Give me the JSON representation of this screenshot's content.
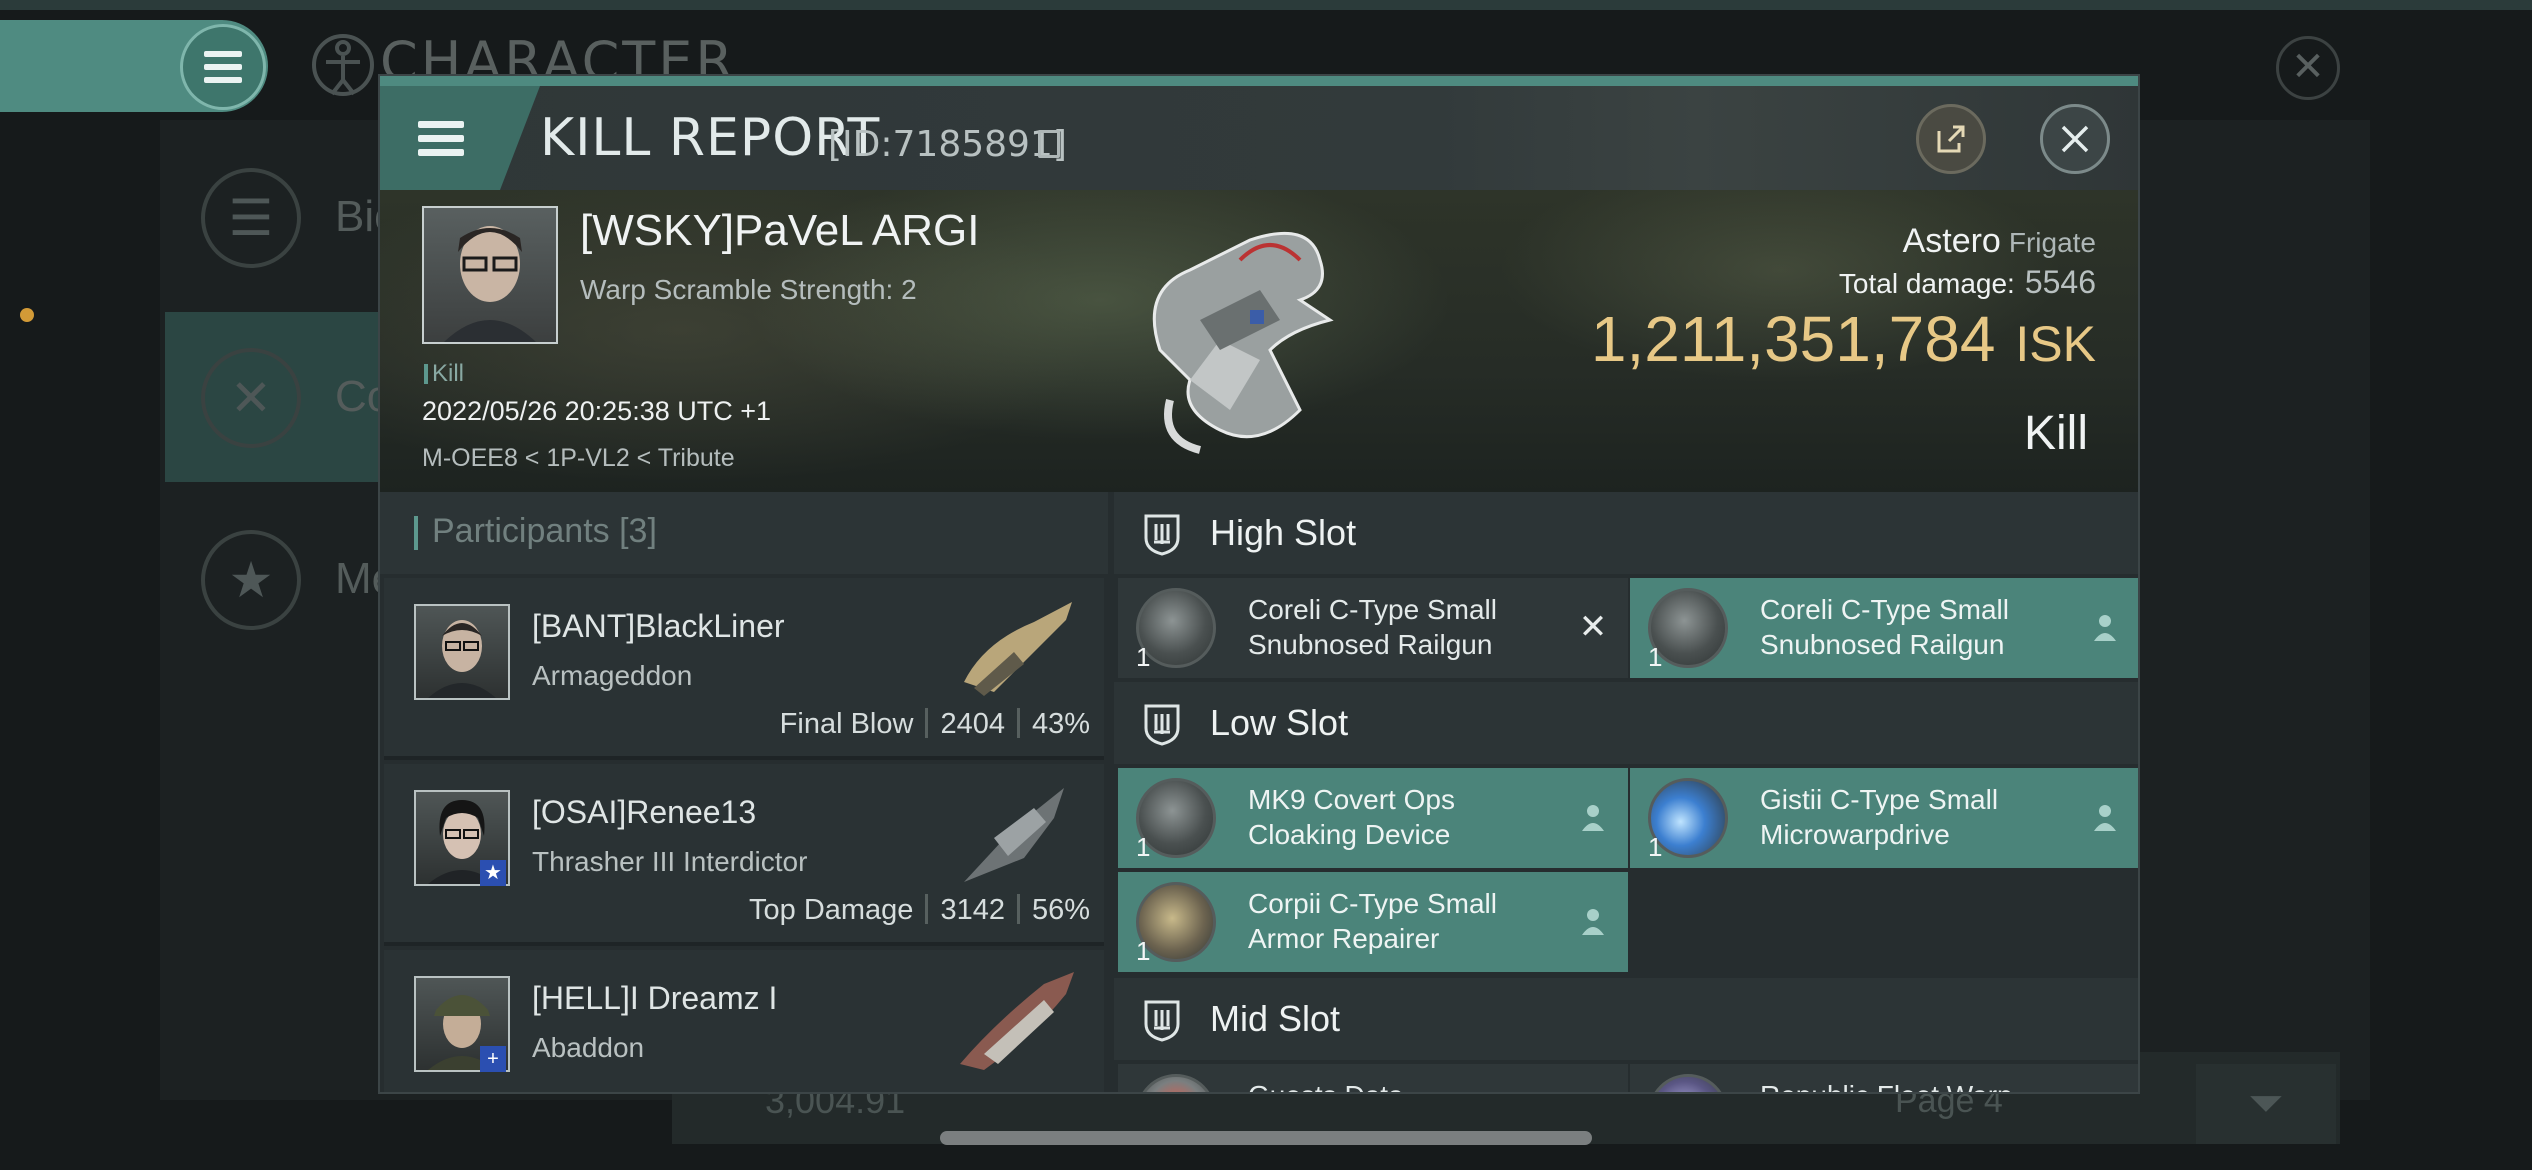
{
  "background": {
    "title": "CHARACTER",
    "sidebar": [
      {
        "label": "Bio",
        "icon": "list-icon"
      },
      {
        "label": "Co",
        "icon": "crossed-swords-icon"
      },
      {
        "label": "Me",
        "icon": "star-badge-icon"
      }
    ],
    "bottom_value": "3,004.91",
    "page_label": "Page 4"
  },
  "kill_report": {
    "title": "KILL REPORT",
    "id_label": "[ID:7185891]",
    "victim": {
      "name": "[WSKY]PaVeL ARGI",
      "subtitle": "Warp Scramble Strength: 2",
      "tag": "Kill",
      "datetime": "2022/05/26 20:25:38 UTC +1",
      "location": "M-OEE8 < 1P-VL2 < Tribute"
    },
    "ship": {
      "name": "Astero",
      "class": "Frigate",
      "total_damage_label": "Total damage:",
      "total_damage": "5546",
      "value": "1,211,351,784",
      "currency": "ISK",
      "result": "Kill"
    },
    "participants": {
      "title": "Participants",
      "count": "[3]",
      "items": [
        {
          "name": "[BANT]BlackLiner",
          "ship": "Armageddon",
          "stat_label": "Final Blow",
          "damage": "2404",
          "percent": "43%",
          "badge": ""
        },
        {
          "name": "[OSAI]Renee13",
          "ship": "Thrasher III Interdictor",
          "stat_label": "Top Damage",
          "damage": "3142",
          "percent": "56%",
          "badge": "★"
        },
        {
          "name": "[HELL]I Dreamz I",
          "ship": "Abaddon",
          "stat_label": "",
          "damage": "",
          "percent": "",
          "badge": "+"
        }
      ]
    },
    "slots": {
      "high": {
        "title": "High Slot",
        "modules": [
          {
            "name": "Coreli C-Type Small Snubnosed Railgun",
            "qty": "1",
            "state": "destroyed"
          },
          {
            "name": "Coreli C-Type Small Snubnosed Railgun",
            "qty": "1",
            "state": "dropped"
          }
        ]
      },
      "low": {
        "title": "Low Slot",
        "modules": [
          {
            "name": "MK9 Covert Ops Cloaking Device",
            "qty": "1",
            "state": "dropped"
          },
          {
            "name": "Gistii C-Type Small Microwarpdrive",
            "qty": "1",
            "state": "dropped"
          },
          {
            "name": "Corpii C-Type Small Armor Repairer",
            "qty": "1",
            "state": "dropped"
          }
        ]
      },
      "mid": {
        "title": "Mid Slot",
        "modules": [
          {
            "name": "Guests Data",
            "qty": "",
            "state": "destroyed"
          },
          {
            "name": "Republic Fleet Warp",
            "qty": "",
            "state": "destroyed"
          }
        ]
      }
    }
  },
  "colors": {
    "accent_teal": "#4b847a",
    "isk_gold": "#e7c886",
    "panel": "#262d2f"
  }
}
